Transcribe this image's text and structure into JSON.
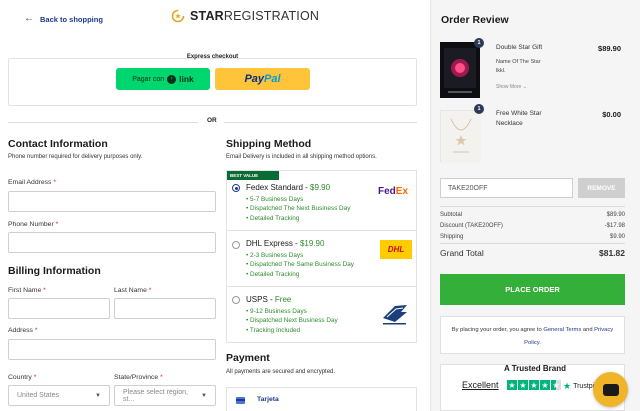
{
  "header": {
    "back_label": "Back to shopping",
    "logo_bold": "STAR",
    "logo_rest": "REGISTRATION"
  },
  "express": {
    "title": "Express checkout",
    "link_prefix": "Pagar con",
    "link_word": "link",
    "paypal_pay": "Pay",
    "paypal_pal": "Pal",
    "or": "OR"
  },
  "contact": {
    "title": "Contact Information",
    "note": "Phone number required for delivery purposes only.",
    "email_label": "Email Address",
    "phone_label": "Phone Number",
    "required_mark": "*"
  },
  "billing": {
    "title": "Billing Information",
    "first_name_label": "First Name",
    "last_name_label": "Last Name",
    "address_label": "Address",
    "country_label": "Country",
    "country_value": "United States",
    "state_label": "State/Province",
    "state_placeholder": "Please select region, st..."
  },
  "shipping": {
    "title": "Shipping Method",
    "note": "Email Delivery is included in all shipping method options.",
    "best_value": "BEST VALUE",
    "options": [
      {
        "name": "Fedex Standard",
        "price": "$9.90",
        "selected": true,
        "carrier": "FedEx",
        "details": [
          "5-7 Business Days",
          "Dispatched The Next Business Day",
          "Detailed Tracking"
        ]
      },
      {
        "name": "DHL Express",
        "price": "$19.90",
        "selected": false,
        "carrier": "DHL",
        "details": [
          "2-3 Business Days",
          "Dispatched The Same Business Day",
          "Detailed Tracking"
        ]
      },
      {
        "name": "USPS",
        "price": "Free",
        "selected": false,
        "carrier": "USPS",
        "details": [
          "9-12 Business Days",
          "Dispatched Next Business Day",
          "Tracking Included"
        ]
      }
    ]
  },
  "payment": {
    "title": "Payment",
    "note": "All payments are secured and encrypted.",
    "method_label": "Tarjeta"
  },
  "order": {
    "title": "Order Review",
    "items": [
      {
        "qty": "1",
        "name": "Double Star Gift",
        "sub1": "Name Of The Star",
        "sub2": "lkkl.",
        "show_more": "Show More",
        "price": "$89.90"
      },
      {
        "qty": "1",
        "name": "Free White Star",
        "sub1": "Necklace",
        "price": "$0.00"
      }
    ],
    "coupon_value": "TAKE20OFF",
    "remove_label": "REMOVE",
    "subtotal_label": "Subtotal",
    "subtotal_value": "$89.90",
    "discount_label": "Discount (TAKE20OFF)",
    "discount_value": "-$17.98",
    "shipping_label": "Shipping",
    "shipping_value": "$9.90",
    "grand_label": "Grand Total",
    "grand_value": "$81.82",
    "place_order": "PLACE ORDER",
    "terms_prefix": "By placing your order, you agree to",
    "terms_link": "General Terms",
    "terms_and": "and",
    "privacy_link": "Privacy Policy",
    "terms_suffix": ".",
    "trusted_title": "A Trusted Brand",
    "trust_rating": "Excellent",
    "trustpilot": "Trustpi"
  },
  "colors": {
    "accent_blue": "#1f3a8a",
    "green": "#34b03a",
    "link_green": "#00d66f",
    "paypal_yellow": "#ffc439",
    "chat_yellow": "#f0b429"
  }
}
